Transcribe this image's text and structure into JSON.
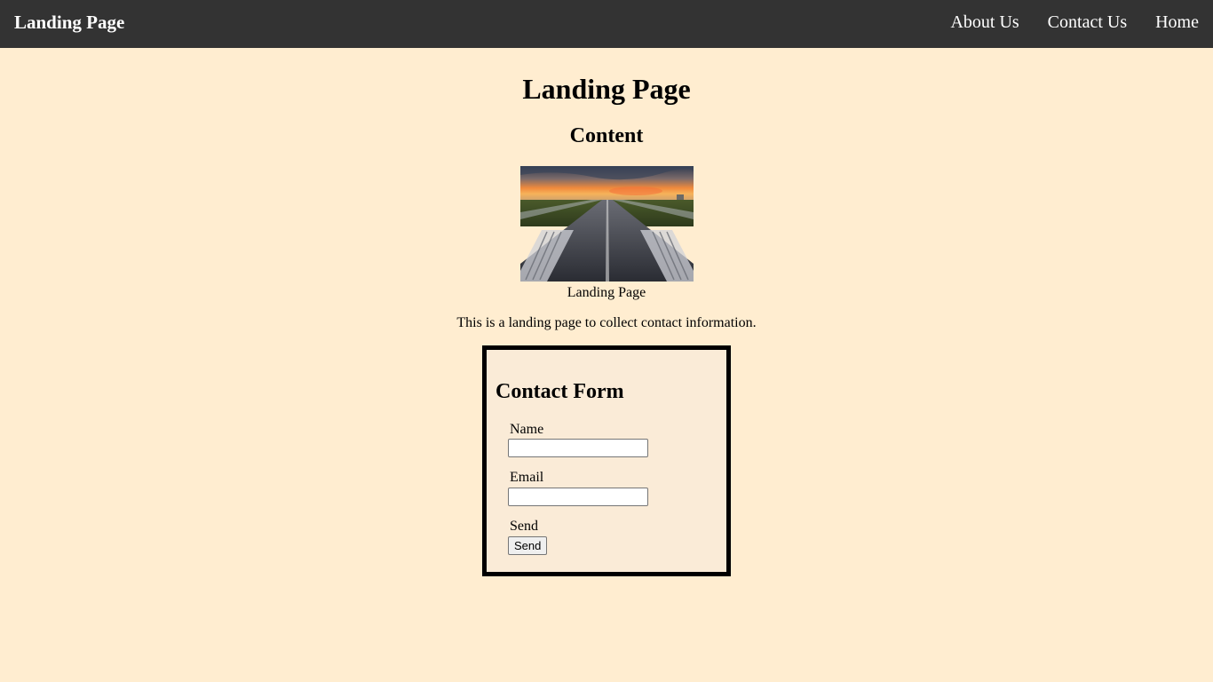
{
  "navbar": {
    "brand": "Landing Page",
    "links": [
      "About Us",
      "Contact Us",
      "Home"
    ]
  },
  "main": {
    "title": "Landing Page",
    "section_title": "Content",
    "image_caption": "Landing Page",
    "description": "This is a landing page to collect contact information."
  },
  "contact_form": {
    "title": "Contact Form",
    "name_label": "Name",
    "name_value": "",
    "email_label": "Email",
    "email_value": "",
    "send_label": "Send",
    "send_button_label": "Send"
  },
  "colors": {
    "navbar_bg": "#333333",
    "page_bg": "#ffedd0",
    "form_bg": "#faebd7",
    "form_border": "#000000"
  }
}
